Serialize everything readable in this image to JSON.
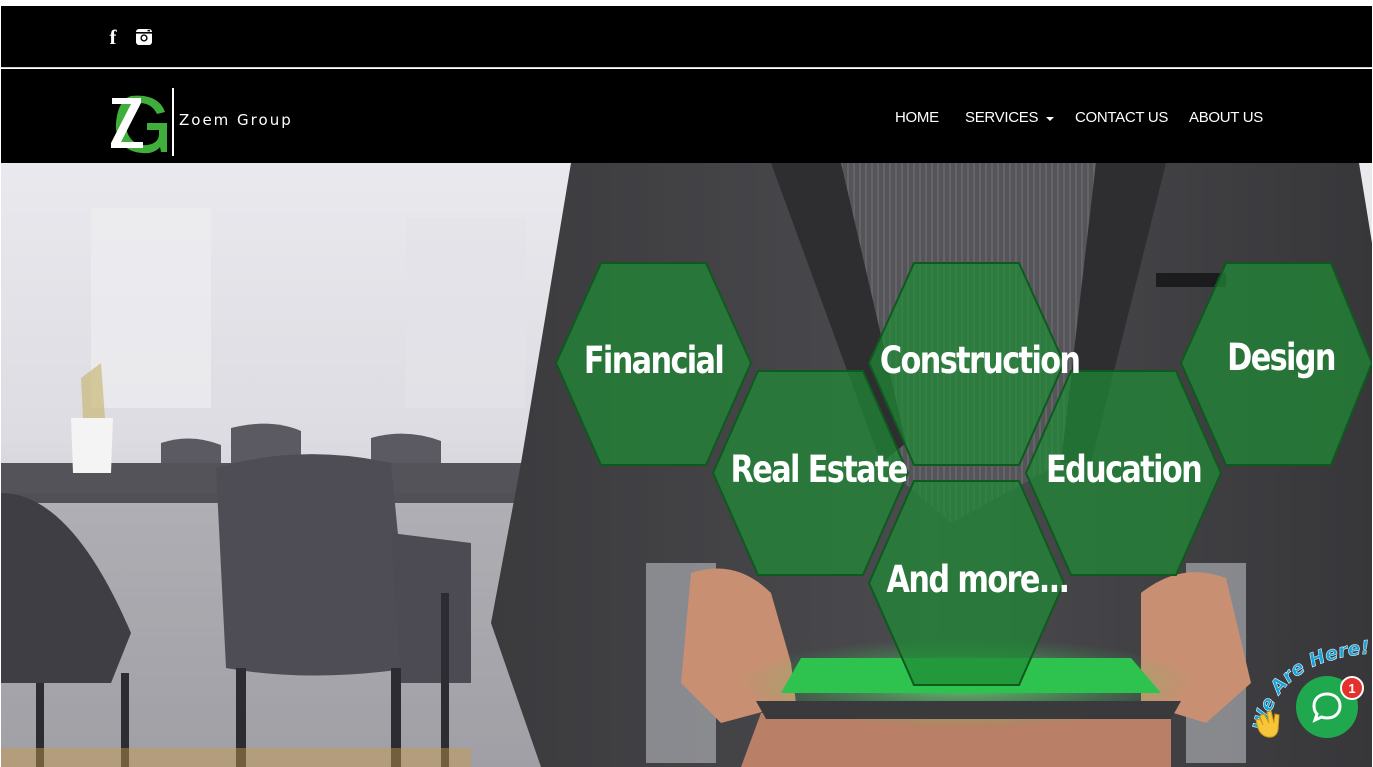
{
  "topbar": {
    "social": [
      {
        "icon": "facebook-icon",
        "glyph": "f"
      },
      {
        "icon": "instagram-icon",
        "glyph": ""
      }
    ]
  },
  "brand": {
    "monogram": "ZG",
    "name": "Zoem Group",
    "colors": {
      "green": "#3fae3a",
      "white": "#ffffff"
    }
  },
  "nav": {
    "items": [
      {
        "label": "HOME",
        "has_dropdown": false
      },
      {
        "label": "SERVICES",
        "has_dropdown": true
      },
      {
        "label": "CONTACT US",
        "has_dropdown": false
      },
      {
        "label": "ABOUT US",
        "has_dropdown": false
      }
    ]
  },
  "hero": {
    "hexagons": [
      {
        "label": "Financial"
      },
      {
        "label": "Construction"
      },
      {
        "label": "Design"
      },
      {
        "label": "Real Estate"
      },
      {
        "label": "Education"
      },
      {
        "label": "And more..."
      }
    ],
    "colors": {
      "hex_fill": "#1f8a35",
      "hex_stroke": "#0e5a1e"
    }
  },
  "chat_widget": {
    "tagline": "We Are Here!",
    "unread_count": "1",
    "wave_icon": "waving-hand-icon",
    "bubble_icon": "chat-bubble-icon",
    "color": "#1fa84e"
  }
}
